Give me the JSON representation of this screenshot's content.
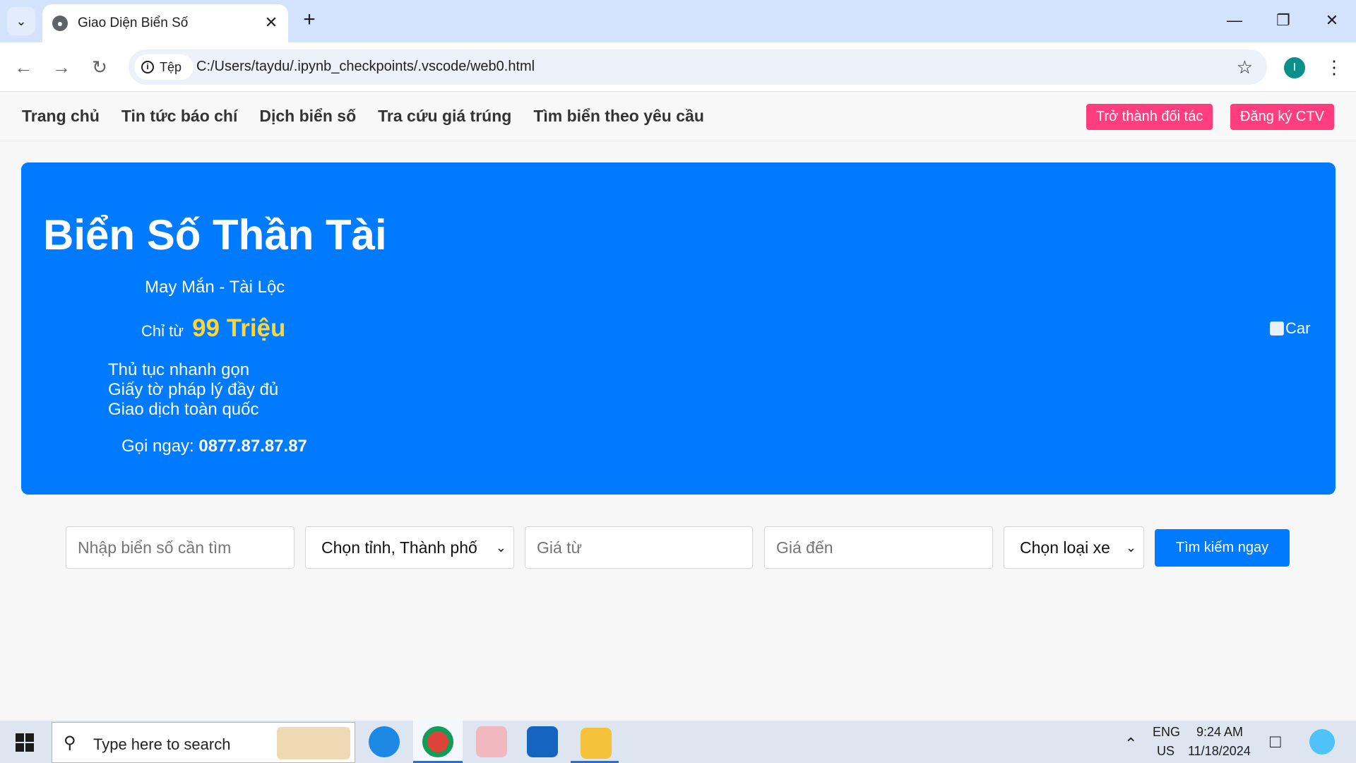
{
  "browser": {
    "tab_title": "Giao Diện Biển Số",
    "chip_label": "Tệp",
    "url": "C:/Users/taydu/.ipynb_checkpoints/.vscode/web0.html",
    "profile_initial": "I"
  },
  "site_nav": {
    "links": [
      "Trang chủ",
      "Tin tức báo chí",
      "Dịch biển số",
      "Tra cứu giá trúng",
      "Tìm biển theo yêu cầu"
    ],
    "partner_button": "Trở thành đối tác",
    "register_button": "Đăng ký CTV"
  },
  "hero": {
    "title": "Biển Số Thần Tài",
    "subtitle": "May Mắn - Tài Lộc",
    "price_prefix": "Chỉ từ",
    "price_amount": "99 Triệu",
    "features": [
      "Thủ tục nhanh gọn",
      "Giấy tờ pháp lý đầy đủ",
      "Giao dịch toàn quốc"
    ],
    "call_label": "Gọi ngay:",
    "phone": "0877.87.87.87",
    "image_alt": "Car"
  },
  "search": {
    "plate_placeholder": "Nhập biển số cần tìm",
    "province_selected": "Chọn tỉnh, Thành phố",
    "price_from_placeholder": "Giá từ",
    "price_to_placeholder": "Giá đến",
    "vehicle_selected": "Chọn loại xe",
    "submit_label": "Tìm kiếm ngay"
  },
  "taskbar": {
    "search_text": "Type here to search",
    "lang_top": "ENG",
    "lang_bottom": "US",
    "time": "9:24 AM",
    "date": "11/18/2024"
  },
  "colors": {
    "hero_bg": "#007bff",
    "accent_pink": "#ff3d7f",
    "price_yellow": "#ffd633",
    "button_blue": "#007bff"
  }
}
